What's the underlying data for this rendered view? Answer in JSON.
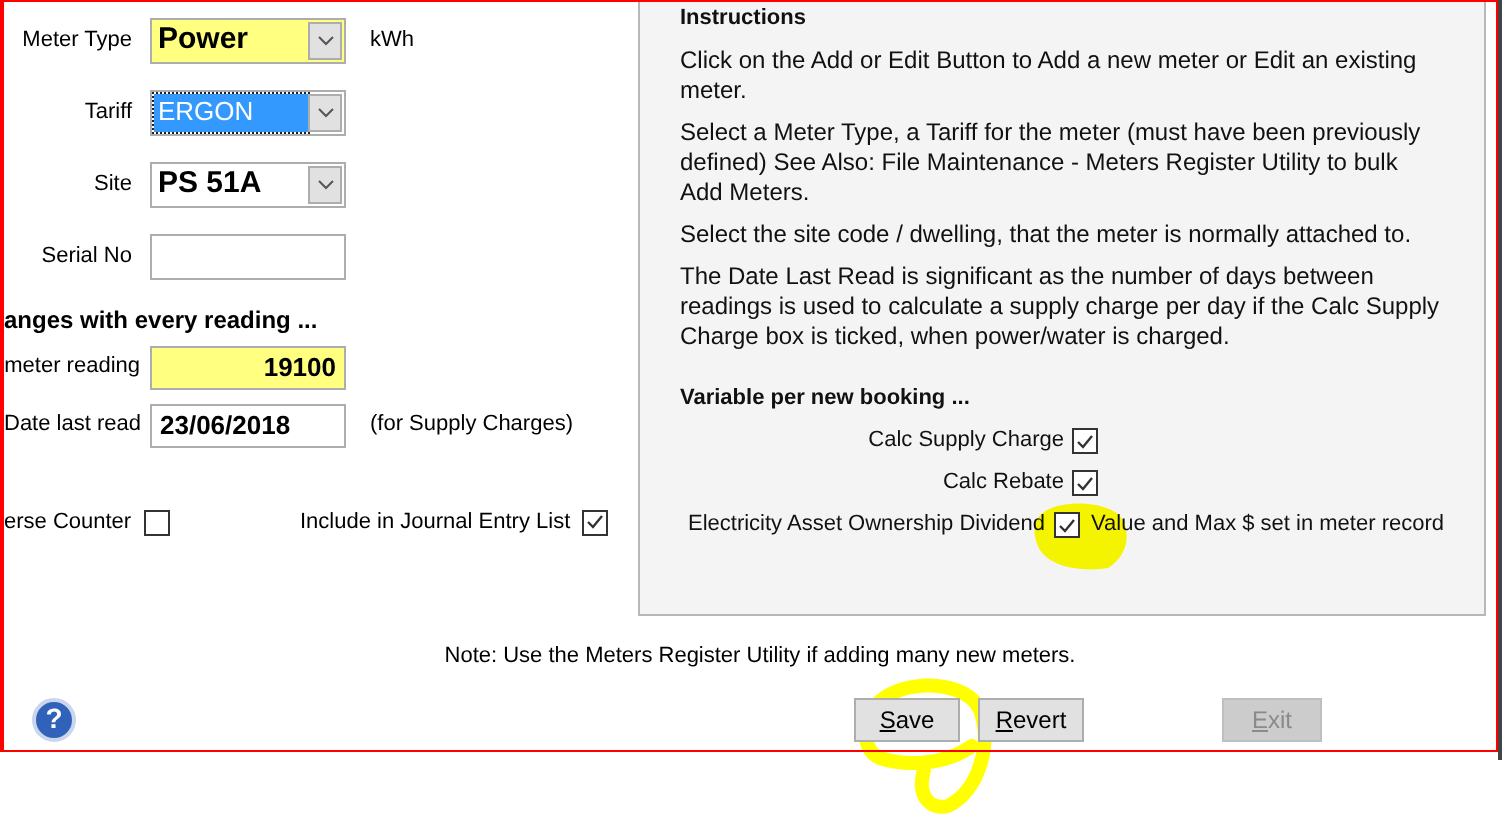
{
  "fields": [
    {
      "kind": "select",
      "label": "Meter Type",
      "value": "Power",
      "required": true,
      "focused": false,
      "note": "kWh"
    },
    {
      "kind": "select",
      "label": "Tariff",
      "value": "ERGON",
      "required": false,
      "focused": true
    },
    {
      "kind": "select",
      "label": "Site",
      "value": "PS  51A",
      "required": false,
      "focused": false
    },
    {
      "kind": "text",
      "label": "Serial No",
      "required": false,
      "focused": false
    }
  ],
  "reading_section": {
    "heading": "anges with every reading ...",
    "fields": [
      {
        "kind": "number",
        "label": "meter reading",
        "value": "19100",
        "required": true
      },
      {
        "kind": "date",
        "label": "Date last read",
        "value": "23/06/2018",
        "required": false,
        "note": "(for Supply Charges)"
      }
    ],
    "checkboxes": [
      {
        "label": "erse Counter",
        "checked": false
      },
      {
        "label": "Include in Journal Entry List",
        "checked": true
      }
    ]
  },
  "instructions": {
    "title": "Instructions",
    "paragraphs": [
      "Click on the Add or Edit Button to Add a new meter or Edit an existing meter.",
      "Select a Meter Type, a Tariff for the meter (must have been previously defined) See Also: File Maintenance - Meters Register Utility to bulk Add Meters.",
      "Select the site code / dwelling, that the meter is normally attached to.",
      "The Date Last Read is significant as the number of days between readings is used to calculate a supply charge per day if the Calc Supply Charge box is ticked, when power/water is charged."
    ],
    "variable_heading": "Variable per new booking ...",
    "checkboxes": [
      {
        "label": "Calc Supply Charge",
        "checked": true
      },
      {
        "label": "Calc Rebate",
        "checked": true
      },
      {
        "label": "Electricity Asset Ownership Dividend",
        "checked": true,
        "note": "Value and Max $ set in meter record"
      }
    ]
  },
  "note": "Note: Use the Meters Register Utility if adding many new meters.",
  "help": {
    "label": "?"
  },
  "buttons": [
    {
      "label": "Save",
      "disabled": false
    },
    {
      "label": "Revert",
      "disabled": false
    },
    {
      "label": "Exit",
      "disabled": true
    }
  ]
}
